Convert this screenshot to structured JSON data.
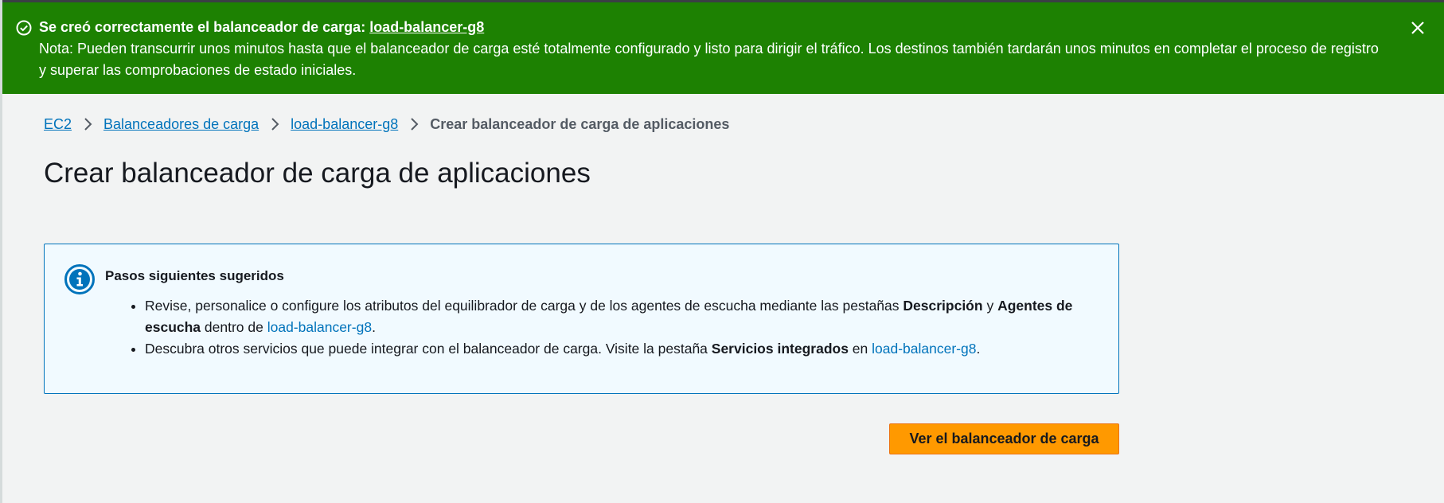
{
  "flash": {
    "title_prefix": "Se creó correctamente el balanceador de carga: ",
    "title_link": "load-balancer-g8",
    "note": "Nota: Pueden transcurrir unos minutos hasta que el balanceador de carga esté totalmente configurado y listo para dirigir el tráfico. Los destinos también tardarán unos minutos en completar el proceso de registro y superar las comprobaciones de estado iniciales.",
    "icon": "check-circle-icon",
    "close_icon": "close-icon",
    "color": "#1d8102"
  },
  "breadcrumb": {
    "items": [
      {
        "label": "EC2"
      },
      {
        "label": "Balanceadores de carga"
      },
      {
        "label": "load-balancer-g8"
      }
    ],
    "current": "Crear balanceador de carga de aplicaciones"
  },
  "page_title": "Crear balanceador de carga de aplicaciones",
  "info": {
    "icon": "info-icon",
    "title": "Pasos siguientes sugeridos",
    "item1": {
      "text_a": "Revise, personalice o configure los atributos del equilibrador de carga y de los agentes de escucha mediante las pestañas ",
      "bold_a": "Descripción",
      "text_b": " y ",
      "bold_b": "Agentes de escucha",
      "text_c": " dentro de ",
      "link": "load-balancer-g8",
      "text_d": "."
    },
    "item2": {
      "text_a": "Descubra otros servicios que puede integrar con el balanceador de carga. Visite la pestaña ",
      "bold_a": "Servicios integrados",
      "text_b": " en ",
      "link": "load-balancer-g8",
      "text_c": "."
    }
  },
  "primary_button": {
    "label": "Ver el balanceador de carga",
    "color": "#ff9900"
  }
}
